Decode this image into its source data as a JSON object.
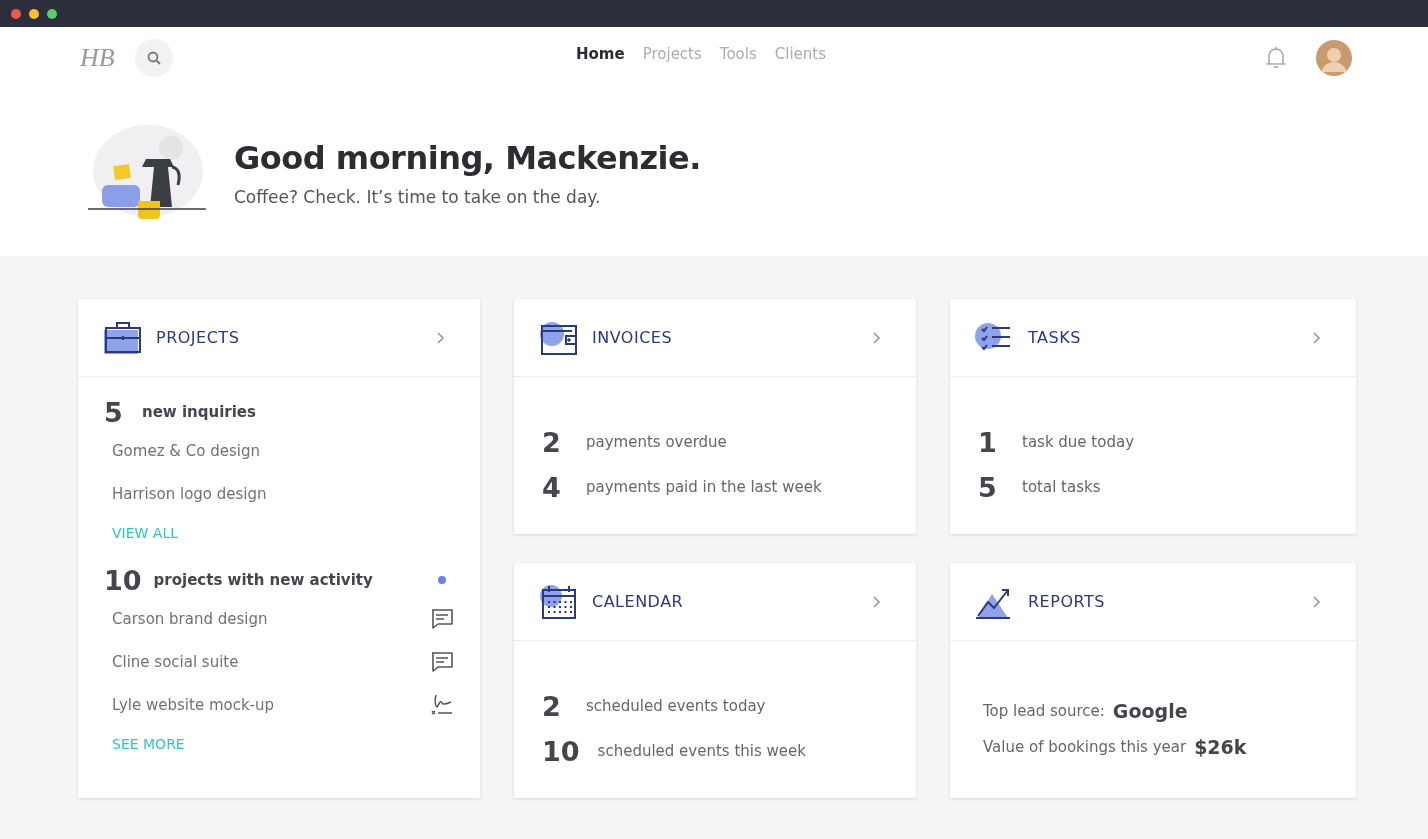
{
  "nav": {
    "logo": "HB",
    "tabs": [
      {
        "label": "Home",
        "selected": true
      },
      {
        "label": "Projects",
        "selected": false
      },
      {
        "label": "Tools",
        "selected": false
      },
      {
        "label": "Clients",
        "selected": false
      }
    ]
  },
  "greeting": {
    "title": "Good morning, Mackenzie.",
    "subtitle": "Coffee? Check. It’s time to take on the day."
  },
  "cards": [
    {
      "kind": "projects",
      "title": "PROJECTS",
      "groups": [
        {
          "count": "5",
          "label": "new inquiries",
          "unread": false,
          "items": [
            {
              "name": "Gomez & Co design",
              "kind": "plain"
            },
            {
              "name": "Harrison logo design",
              "kind": "plain"
            }
          ],
          "link": "VIEW ALL"
        },
        {
          "count": "10",
          "label": "projects with new activity",
          "unread": true,
          "items": [
            {
              "name": "Carson brand design",
              "kind": "comment"
            },
            {
              "name": "Cline social suite",
              "kind": "comment"
            },
            {
              "name": "Lyle website mock-up",
              "kind": "signature"
            }
          ],
          "link": "SEE MORE"
        }
      ]
    },
    {
      "kind": "invoices",
      "title": "INVOICES",
      "stats": [
        {
          "count": "2",
          "label": "payments overdue"
        },
        {
          "count": "4",
          "label": "payments paid in the last week"
        }
      ]
    },
    {
      "kind": "tasks",
      "title": "TASKS",
      "stats": [
        {
          "count": "1",
          "label": "task due today"
        },
        {
          "count": "5",
          "label": "total tasks"
        }
      ]
    },
    {
      "kind": "calendar",
      "title": "CALENDAR",
      "stats": [
        {
          "count": "2",
          "label": "scheduled events today"
        },
        {
          "count": "10",
          "label": "scheduled events this week"
        }
      ]
    },
    {
      "kind": "reports",
      "title": "REPORTS",
      "metrics": [
        {
          "label": "Top lead source:",
          "value": "Google"
        },
        {
          "label": "Value of bookings this year",
          "value": "$26k"
        }
      ]
    }
  ]
}
